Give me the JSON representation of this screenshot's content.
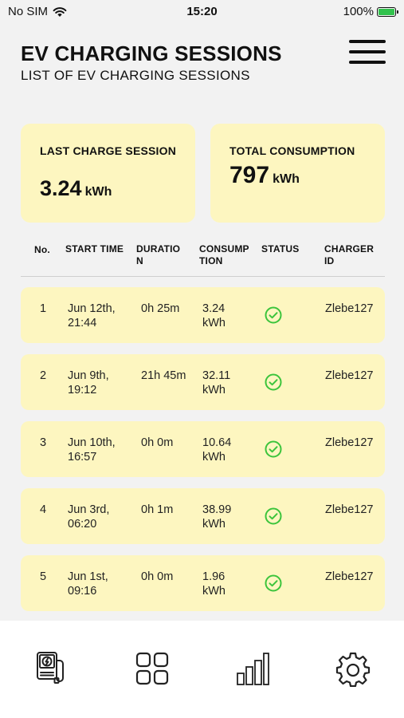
{
  "status_bar": {
    "carrier": "No SIM",
    "time": "15:20",
    "battery": "100%"
  },
  "header": {
    "title": "EV CHARGING SESSIONS",
    "subtitle": "LIST OF EV CHARGING SESSIONS",
    "menu_icon": "hamburger-menu-icon"
  },
  "summary": {
    "last_session": {
      "label": "LAST CHARGE SESSION",
      "value": "3.24",
      "unit": "kWh"
    },
    "total": {
      "label": "TOTAL CONSUMPTION",
      "value": "797",
      "unit": "kWh"
    }
  },
  "table": {
    "columns": [
      "No.",
      "START TIME",
      "DURATIO N",
      "CONSUMP TION",
      "STATUS",
      "CHARGER ID"
    ],
    "rows": [
      {
        "no": "1",
        "start": "Jun 12th, 21:44",
        "duration": "0h 25m",
        "consumption": "3.24 kWh",
        "status": "success",
        "charger": "Zlebe127"
      },
      {
        "no": "2",
        "start": "Jun 9th, 19:12",
        "duration": "21h 45m",
        "consumption": "32.11 kWh",
        "status": "success",
        "charger": "Zlebe127"
      },
      {
        "no": "3",
        "start": "Jun 10th, 16:57",
        "duration": "0h 0m",
        "consumption": "10.64 kWh",
        "status": "success",
        "charger": "Zlebe127"
      },
      {
        "no": "4",
        "start": "Jun 3rd, 06:20",
        "duration": "0h 1m",
        "consumption": "38.99 kWh",
        "status": "success",
        "charger": "Zlebe127"
      },
      {
        "no": "5",
        "start": "Jun 1st, 09:16",
        "duration": "0h 0m",
        "consumption": "1.96 kWh",
        "status": "success",
        "charger": "Zlebe127"
      }
    ]
  },
  "bottom_nav": [
    "charger-icon",
    "dashboard-grid-icon",
    "statistics-bars-icon",
    "settings-gear-icon"
  ],
  "colors": {
    "card": "#fdf6c0",
    "status_ok": "#3cc43c",
    "background": "#f2f2f2"
  }
}
